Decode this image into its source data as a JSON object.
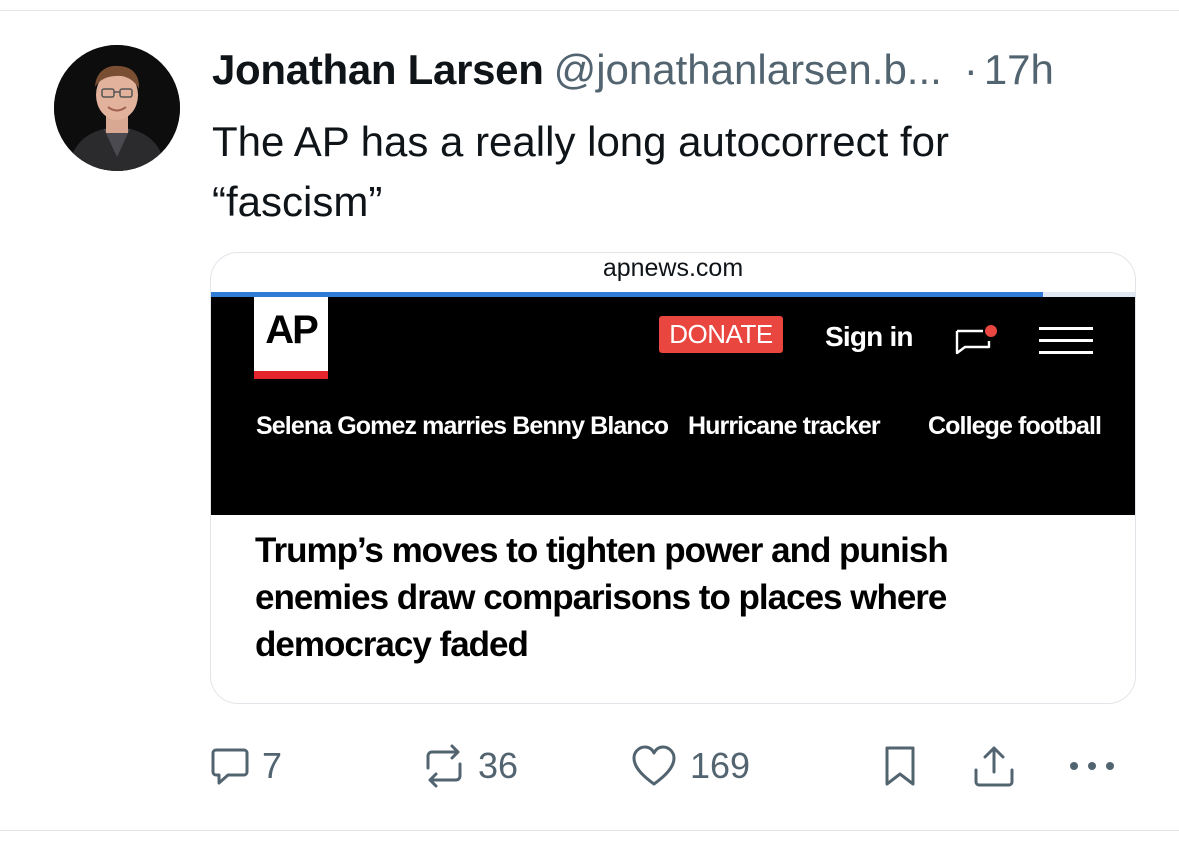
{
  "tweet": {
    "author_name": "Jonathan Larsen",
    "author_handle": "@jonathanlarsen.b...",
    "separator": "·",
    "timestamp": "17h",
    "text": "The AP has a really long autocorrect for\n“fascism”"
  },
  "link_card": {
    "domain": "apnews.com",
    "page_load_progress": 0.9,
    "site": {
      "logo_text": "AP",
      "donate_label": "DONATE",
      "signin_label": "Sign in",
      "trending_topics": [
        "Selena Gomez marries Benny Blanco",
        "Hurricane tracker",
        "College football"
      ],
      "headline": "Trump’s moves to tighten power and punish enemies draw comparisons to places where democracy faded"
    }
  },
  "actions": {
    "reply_count": "7",
    "repost_count": "36",
    "like_count": "169"
  },
  "icons": [
    "reply-icon",
    "repost-icon",
    "like-icon",
    "bookmark-icon",
    "share-icon",
    "more-icon",
    "chat-icon",
    "menu-icon"
  ],
  "colors": {
    "text_primary": "#0f1419",
    "text_secondary": "#536471",
    "ap_red": "#e4252c",
    "donate_red": "#e8463f",
    "progress_blue": "#2f7bd6",
    "divider": "#e3e6e9"
  }
}
